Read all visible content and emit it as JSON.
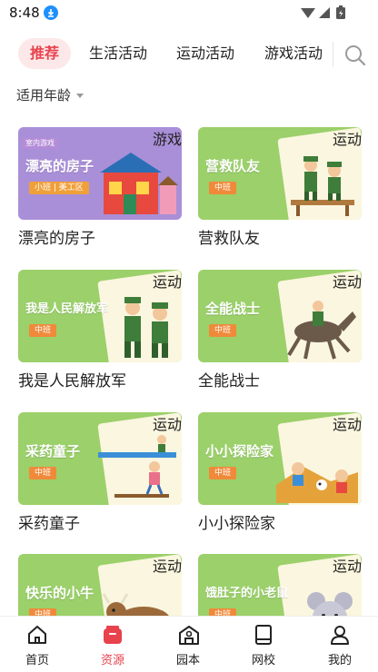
{
  "status_bar": {
    "time": "8:48"
  },
  "tabs": [
    {
      "label": "推荐",
      "active": true
    },
    {
      "label": "生活活动",
      "active": false
    },
    {
      "label": "运动活动",
      "active": false
    },
    {
      "label": "游戏活动",
      "active": false
    }
  ],
  "filter": {
    "label": "适用年龄"
  },
  "cards": [
    {
      "title": "漂亮的房子",
      "badge": "游戏",
      "headline": "漂亮的房子",
      "level": "小班 | 美工区",
      "tag": "室内游戏",
      "theme": "purple"
    },
    {
      "title": "营救队友",
      "badge": "运动",
      "headline": "营救队友",
      "level": "中班",
      "theme": "green"
    },
    {
      "title": "我是人民解放军",
      "badge": "运动",
      "headline": "我是人民解放军",
      "level": "中班",
      "theme": "green"
    },
    {
      "title": "全能战士",
      "badge": "运动",
      "headline": "全能战士",
      "level": "中班",
      "theme": "green"
    },
    {
      "title": "采药童子",
      "badge": "运动",
      "headline": "采药童子",
      "level": "中班",
      "theme": "green"
    },
    {
      "title": "小小探险家",
      "badge": "运动",
      "headline": "小小探险家",
      "level": "中班",
      "theme": "green"
    },
    {
      "badge": "运动",
      "headline": "快乐的小牛",
      "level": "中班",
      "theme": "green"
    },
    {
      "badge": "运动",
      "headline": "饿肚子的小老鼠",
      "level": "中班",
      "theme": "green"
    }
  ],
  "bottom_nav": [
    {
      "label": "首页",
      "icon": "home-icon",
      "active": false
    },
    {
      "label": "资源",
      "icon": "resource-icon",
      "active": true
    },
    {
      "label": "园本",
      "icon": "school-icon",
      "active": false
    },
    {
      "label": "网校",
      "icon": "book-icon",
      "active": false
    },
    {
      "label": "我的",
      "icon": "user-icon",
      "active": false
    }
  ],
  "colors": {
    "accent": "#e8424d",
    "accent_bg": "#fde8e9",
    "card_green": "#9bd06a",
    "card_purple": "#a98fd8",
    "level_orange": "#f08a3a"
  }
}
